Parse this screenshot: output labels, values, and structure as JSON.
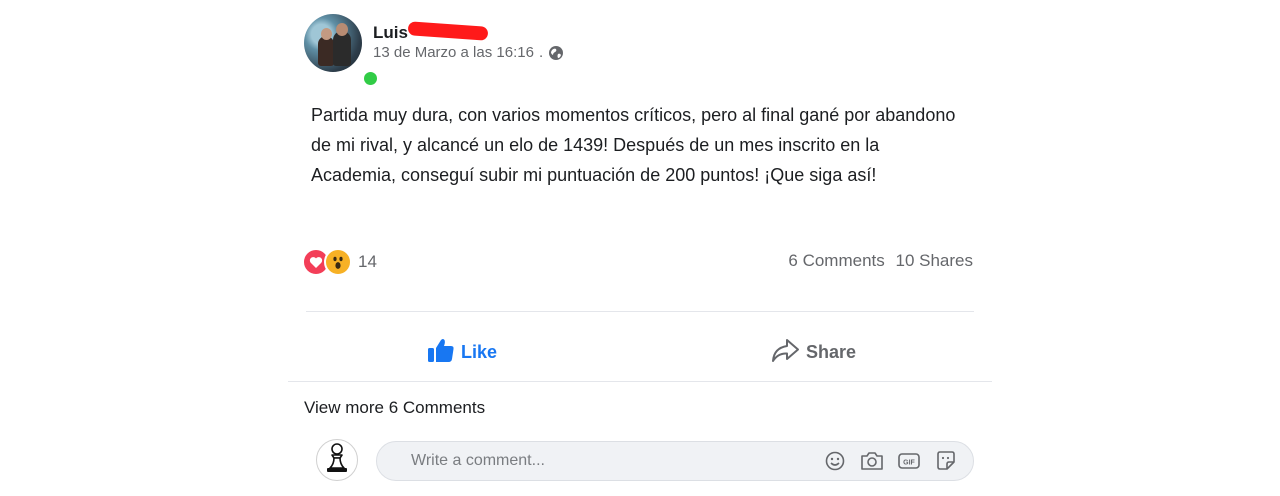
{
  "post": {
    "author": "Luis",
    "timestamp": "13 de Marzo a las 16:16",
    "separator": ".",
    "privacy_icon": "globe-icon",
    "text": "Partida muy dura, con varios momentos críticos, pero al final gané por abandono de mi rival, y alcancé un elo de 1439! Después de un mes inscrito en la Academia, conseguí subir mi puntuación de 200 puntos! ¡Que siga así!",
    "reactions": {
      "types": [
        "love",
        "wow"
      ],
      "count": "14"
    },
    "comments_count": "6 Comments",
    "shares_count": "10 Shares"
  },
  "actions": {
    "like_label": "Like",
    "share_label": "Share"
  },
  "comments": {
    "view_more": "View more 6 Comments",
    "placeholder": "Write a comment..."
  },
  "colors": {
    "like_blue": "#1877f2",
    "love_red": "#f33e58",
    "wow_yellow": "#f7b125",
    "online_green": "#31cc46",
    "muted_text": "#65676b"
  }
}
